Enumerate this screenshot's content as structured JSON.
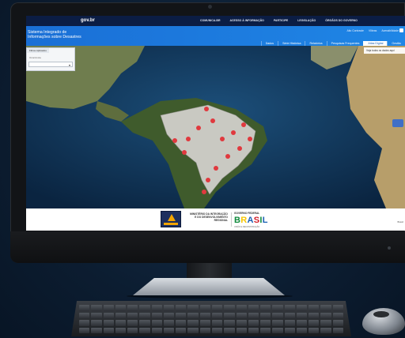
{
  "gov_bar": {
    "logo": "gov.br",
    "menu": [
      "COMUNICA-BR",
      "ACESSO À INFORMAÇÃO",
      "PARTICIPE",
      "LEGISLAÇÃO",
      "ÓRGÃOS DO GOVERNO"
    ]
  },
  "header": {
    "site_title": "Sistema Integrado de Informações sobre Desastres",
    "util_links": [
      "Alto Contraste",
      "Vlibras",
      "Acessibilidade"
    ]
  },
  "tabs": [
    "Dados",
    "Série Histórica",
    "Relatórios",
    "Pesquisas Frequentes",
    "Atlas Digital",
    "Gestão"
  ],
  "active_tab": "Atlas Digital",
  "filter_panel": {
    "tab": "Filtros Aplicados",
    "label": "Ocorrência",
    "select_value": ""
  },
  "map_hint": "Veja todos os dados aqui",
  "footer": {
    "ministry": "MINISTÉRIO DA INTEGRAÇÃO E DO DESENVOLVIMENTO REGIONAL",
    "gov_federal": "GOVERNO FEDERAL",
    "brasil": [
      "B",
      "R",
      "A",
      "S",
      "I",
      "L"
    ],
    "brasil_sub": "UNIÃO E RECONSTRUÇÃO",
    "right_text": "Brasil"
  },
  "colors": {
    "gov_bar": "#0b1d44",
    "header": "#1f86e6",
    "marker": "#e0393e",
    "ocean": "#0b2a4a",
    "brazil_fill": "#c9c9c2"
  },
  "icons": {
    "search": "search-icon",
    "chevron": "chevron-down-icon"
  }
}
